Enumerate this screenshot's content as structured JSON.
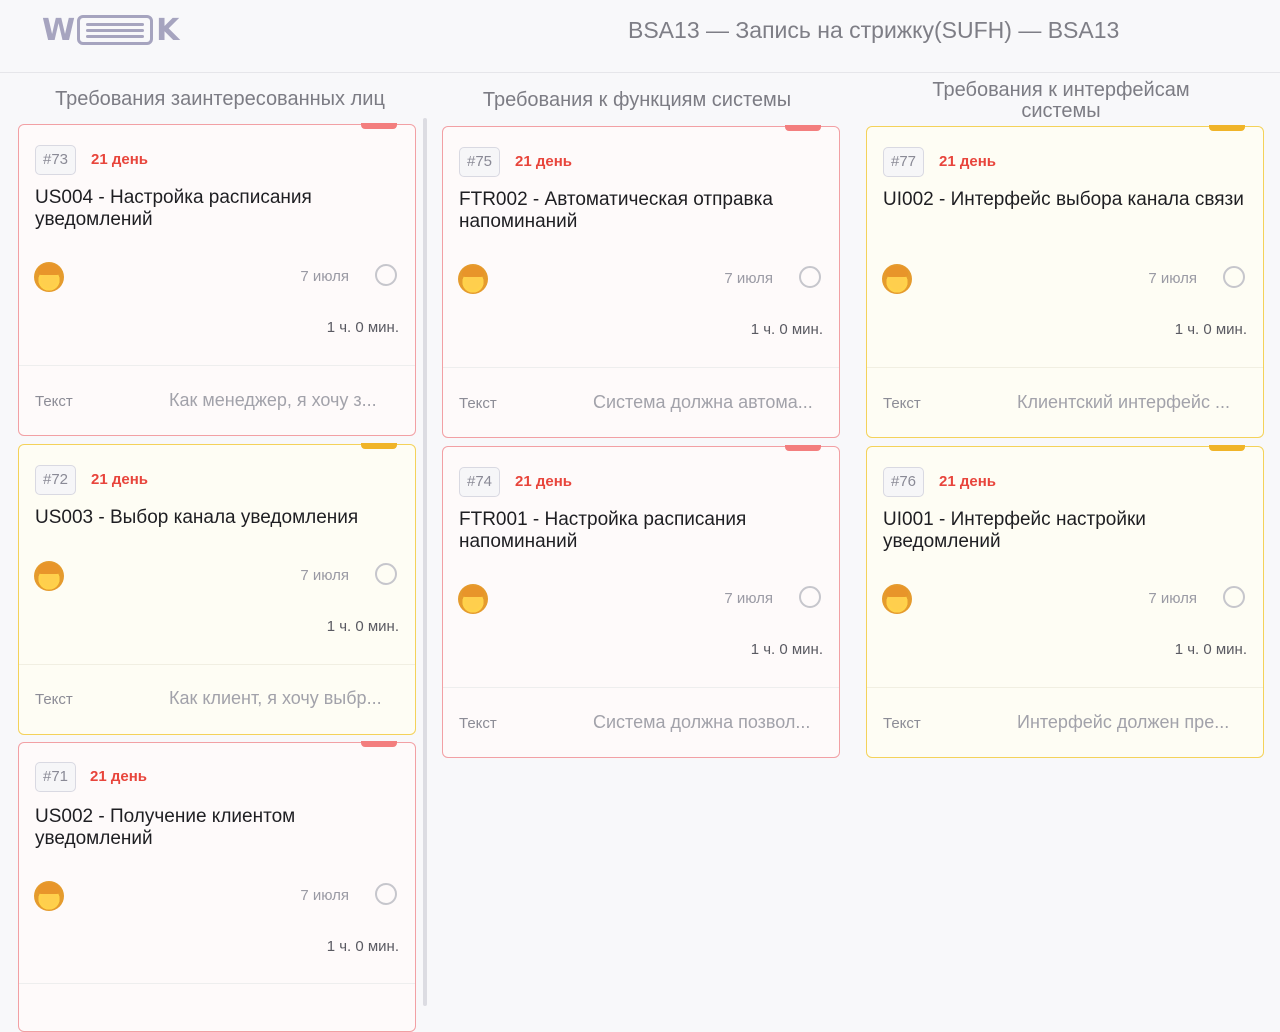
{
  "header": {
    "logo": "WEEEK",
    "board_title": "BSA13 — Запись на стрижку(SUFH) — BSA13"
  },
  "columns": [
    {
      "title": "Требования заинтересованных лиц",
      "cards": [
        {
          "number": "#73",
          "days": "21 день",
          "title": "US004 - Настройка расписания уведомлений",
          "date": "7 июля",
          "duration": "1 ч. 0 мин.",
          "field_label": "Текст",
          "field_value": "Как менеджер, я хочу з...",
          "accent": "red"
        },
        {
          "number": "#72",
          "days": "21 день",
          "title": "US003 - Выбор канала уведомления",
          "date": "7 июля",
          "duration": "1 ч. 0 мин.",
          "field_label": "Текст",
          "field_value": "Как клиент, я хочу выбр...",
          "accent": "yellow"
        },
        {
          "number": "#71",
          "days": "21 день",
          "title": "US002 - Получение клиентом уведомлений",
          "date": "7 июля",
          "duration": "1 ч. 0 мин.",
          "field_label": "",
          "field_value": "",
          "accent": "red"
        }
      ]
    },
    {
      "title": "Требования к функциям системы",
      "cards": [
        {
          "number": "#75",
          "days": "21 день",
          "title": "FTR002 - Автоматическая отправка напоминаний",
          "date": "7 июля",
          "duration": "1 ч. 0 мин.",
          "field_label": "Текст",
          "field_value": "Система должна автома...",
          "accent": "red"
        },
        {
          "number": "#74",
          "days": "21 день",
          "title": "FTR001 - Настройка расписания напоминаний",
          "date": "7 июля",
          "duration": "1 ч. 0 мин.",
          "field_label": "Текст",
          "field_value": "Система должна позвол...",
          "accent": "red"
        }
      ]
    },
    {
      "title": "Требования к интерфейсам системы",
      "cards": [
        {
          "number": "#77",
          "days": "21 день",
          "title": "UI002 - Интерфейс выбора канала связи",
          "date": "7 июля",
          "duration": "1 ч. 0 мин.",
          "field_label": "Текст",
          "field_value": "Клиентский интерфейс ...",
          "accent": "yellow"
        },
        {
          "number": "#76",
          "days": "21 день",
          "title": "UI001 - Интерфейс настройки уведомлений",
          "date": "7 июля",
          "duration": "1 ч. 0 мин.",
          "field_label": "Текст",
          "field_value": "Интерфейс должен пре...",
          "accent": "yellow"
        }
      ]
    }
  ],
  "colors": {
    "red_accent": "#f37e7e",
    "yellow_accent": "#f0b429",
    "days_text": "#e8453c"
  },
  "icons": {
    "avatar": "avatar-emoji-woman",
    "check": "circle-checkbox"
  }
}
